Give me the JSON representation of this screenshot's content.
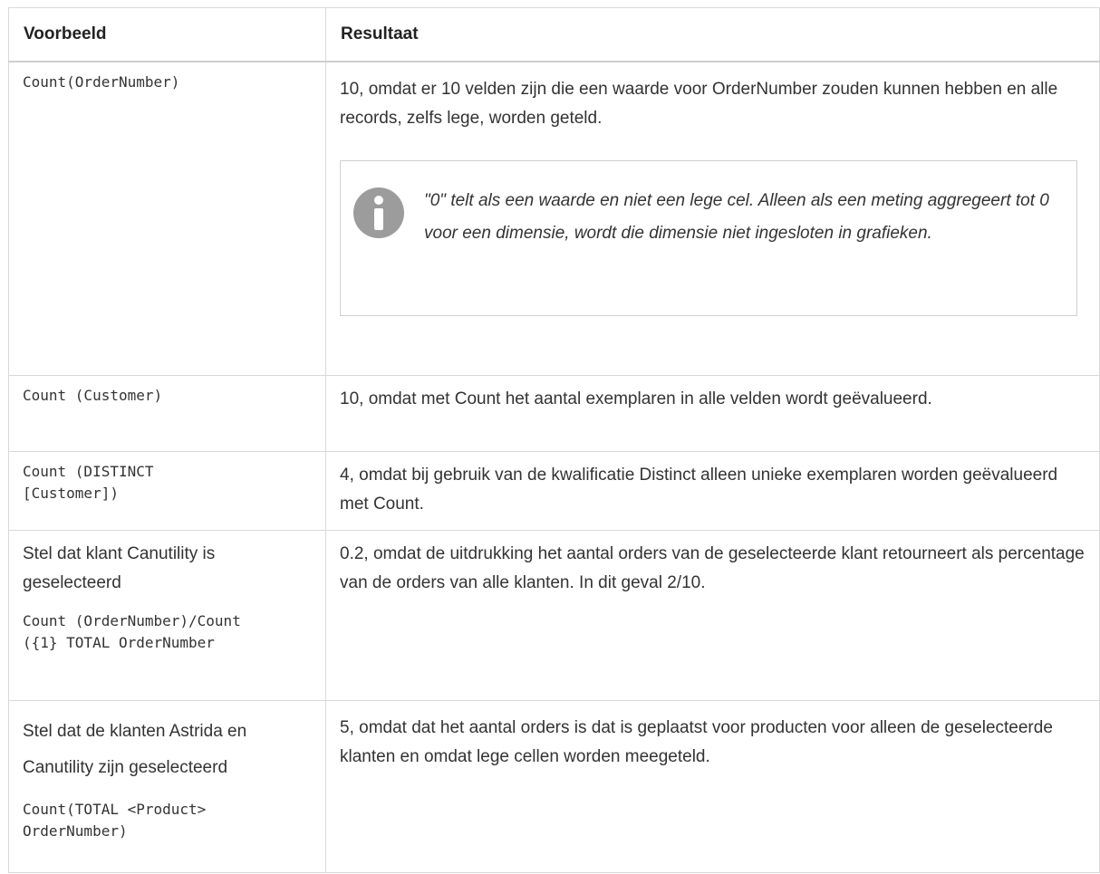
{
  "table": {
    "headers": [
      "Voorbeeld",
      "Resultaat"
    ],
    "rows": [
      {
        "example_text": "",
        "example_code": "Count(OrderNumber)",
        "result": "10, omdat er 10 velden zijn die een waarde voor OrderNumber zouden kunnen hebben en alle records, zelfs lege, worden geteld.",
        "note": "\"0\" telt als een waarde en niet een lege cel. Alleen als een meting aggregeert tot 0 voor een dimensie, wordt die dimensie niet ingesloten in grafieken."
      },
      {
        "example_text": "",
        "example_code": "Count (Customer)",
        "result": "10, omdat met Count het aantal exemplaren in alle velden wordt geëvalueerd."
      },
      {
        "example_text": "",
        "example_code": "Count (DISTINCT [Customer])",
        "result": "4, omdat bij gebruik van de kwalificatie Distinct alleen unieke exemplaren worden geëvalueerd met Count."
      },
      {
        "example_text": "Stel dat klant Canutility is geselecteerd",
        "example_code": "Count (OrderNumber)/Count ({1} TOTAL OrderNumber",
        "result": "0.2, omdat de uitdrukking het aantal orders van de geselecteerde klant retourneert als percentage van de orders van alle klanten. In dit geval 2/10."
      },
      {
        "example_text": "Stel dat de klanten Astrida en Canutility  zijn geselecteerd",
        "example_code": "Count(TOTAL <Product> OrderNumber)",
        "result": "5, omdat dat het aantal orders is dat is geplaatst voor producten voor alleen de geselecteerde klanten en omdat lege cellen worden meegeteld."
      }
    ]
  },
  "icons": {
    "note": "info-icon"
  },
  "colors": {
    "note_icon": "#9c9c9c",
    "border": "#d9d9d9"
  }
}
